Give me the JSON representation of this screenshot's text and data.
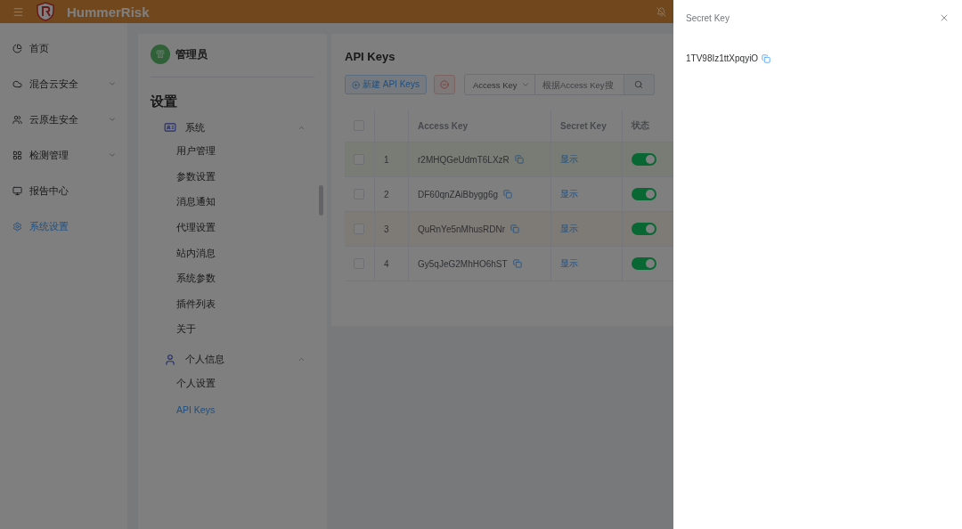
{
  "header": {
    "brand": "HummerRisk"
  },
  "sidebar": {
    "items": [
      {
        "label": "首页",
        "kind": "item",
        "selected": false
      },
      {
        "label": "混合云安全",
        "kind": "submenu",
        "expanded": false,
        "selected": false
      },
      {
        "label": "云原生安全",
        "kind": "submenu",
        "expanded": false,
        "selected": false
      },
      {
        "label": "检测管理",
        "kind": "submenu",
        "expanded": false,
        "selected": false
      },
      {
        "label": "报告中心",
        "kind": "item",
        "selected": false
      },
      {
        "label": "系统设置",
        "kind": "item",
        "selected": true
      }
    ]
  },
  "settings_panel": {
    "avatar": "管",
    "user": "管理员",
    "heading": "设置",
    "groups": [
      {
        "label": "系统",
        "expanded": true,
        "items": [
          {
            "label": "用户管理",
            "selected": false
          },
          {
            "label": "参数设置",
            "selected": false
          },
          {
            "label": "消息通知",
            "selected": false
          },
          {
            "label": "代理设置",
            "selected": false
          },
          {
            "label": "站内消息",
            "selected": false
          },
          {
            "label": "系统参数",
            "selected": false
          },
          {
            "label": "插件列表",
            "selected": false
          },
          {
            "label": "关于",
            "selected": false
          }
        ]
      },
      {
        "label": "个人信息",
        "expanded": true,
        "items": [
          {
            "label": "个人设置",
            "selected": false
          },
          {
            "label": "API Keys",
            "selected": true
          }
        ]
      }
    ]
  },
  "main": {
    "title": "API Keys",
    "create_button": "新建 API Keys",
    "search_field": {
      "value": "Access Key",
      "placeholder": "根据Access Key搜"
    },
    "table": {
      "columns": [
        "Access Key",
        "Secret Key",
        "状态"
      ],
      "header_checked": false,
      "rows": [
        {
          "index": "1",
          "access_key": "r2MHQGeUdmT6LXzR",
          "secret": "显示",
          "on": true,
          "checked": false,
          "kind": "success"
        },
        {
          "index": "2",
          "access_key": "DF60qnZAiBbygg6g",
          "secret": "显示",
          "on": true,
          "checked": false,
          "kind": "plain"
        },
        {
          "index": "3",
          "access_key": "QuRnYe5nMhusRDNr",
          "secret": "显示",
          "on": true,
          "checked": false,
          "kind": "warning"
        },
        {
          "index": "4",
          "access_key": "Gy5qJeG2MhHO6hST",
          "secret": "显示",
          "on": true,
          "checked": false,
          "kind": "plain"
        }
      ]
    }
  },
  "drawer": {
    "title": "Secret Key",
    "value": "1TV98Iz1ttXpqyiO"
  }
}
